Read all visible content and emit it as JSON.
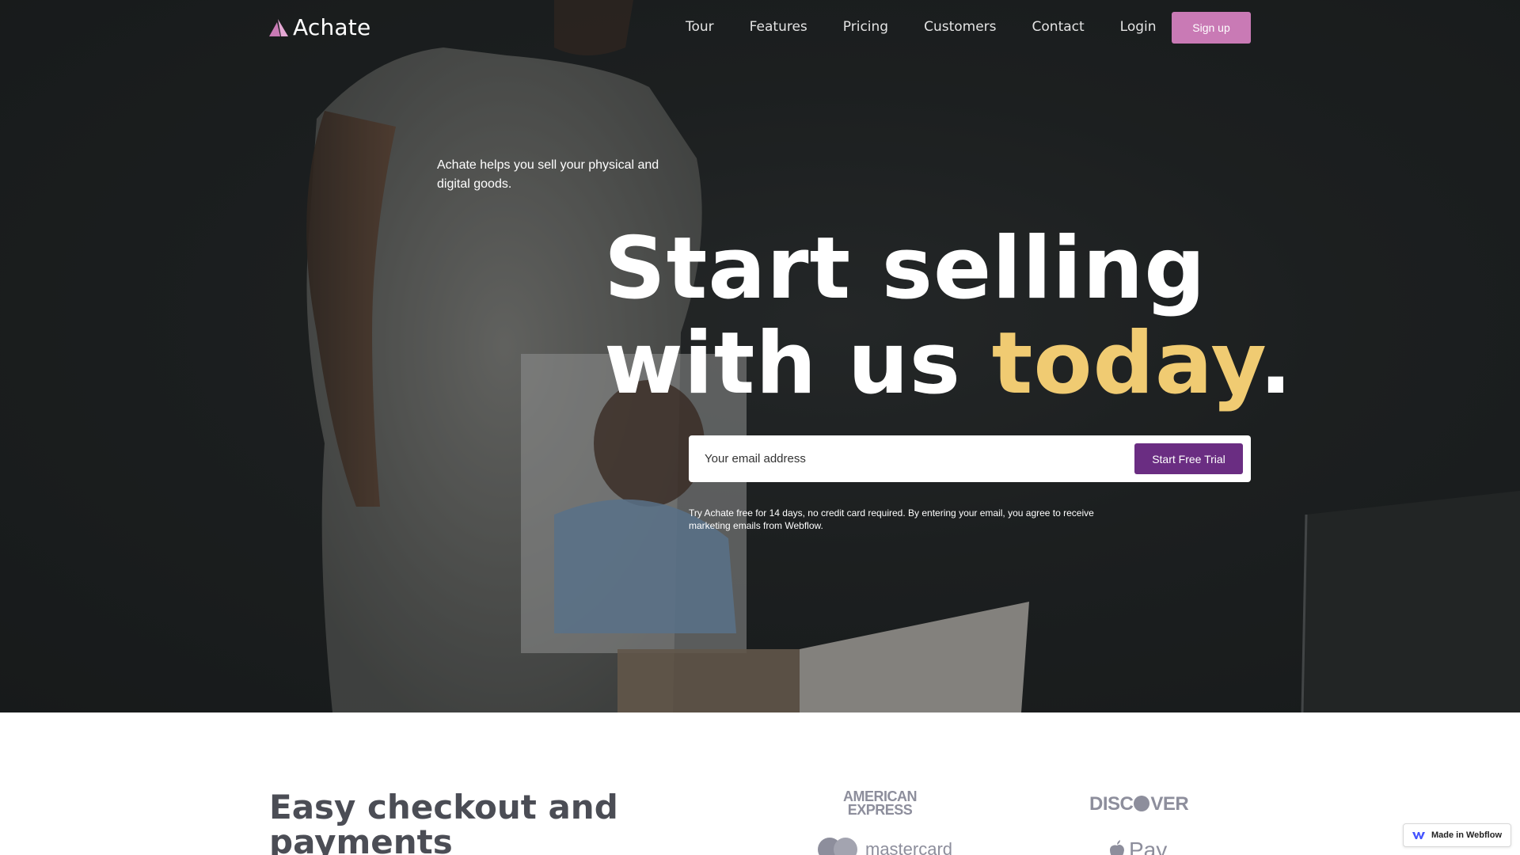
{
  "nav": {
    "brand": "Achate",
    "links": [
      "Tour",
      "Features",
      "Pricing",
      "Customers",
      "Contact",
      "Login"
    ],
    "signup_label": "Sign up"
  },
  "hero": {
    "subtitle": "Achate helps you sell your physical and digital goods.",
    "title_line1": "Start selling",
    "title_line2_prefix": "with us ",
    "title_line2_accent": "today",
    "title_line2_suffix": ".",
    "email_placeholder": "Your email address",
    "cta_label": "Start Free Trial",
    "disclaimer": "Try Achate free for 14 days, no credit card required. By entering your email, you agree to receive marketing emails from Webflow."
  },
  "checkout": {
    "title": "Easy checkout and payments",
    "logos": {
      "amex_line1": "AMERICAN",
      "amex_line2": "EXPRESS",
      "discover_left": "DISC",
      "discover_right": "VER",
      "mastercard": "mastercard",
      "applepay": "Pay"
    }
  },
  "badge": {
    "label": "Made in Webflow"
  },
  "colors": {
    "brand_pink": "#c97ab5",
    "cta_purple": "#6a2d82",
    "accent_gold": "#f0cb72"
  },
  "icons": [
    "achate-logo-icon",
    "webflow-icon",
    "apple-icon"
  ]
}
